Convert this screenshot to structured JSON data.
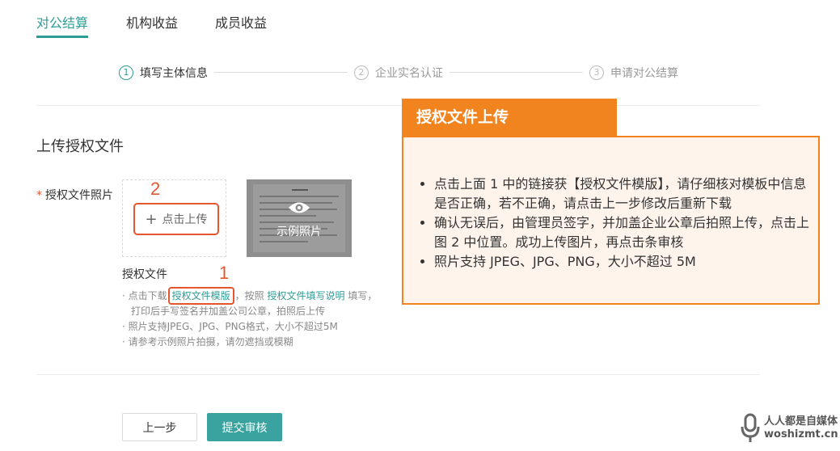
{
  "tabs": [
    {
      "label": "对公结算",
      "active": true
    },
    {
      "label": "机构收益",
      "active": false
    },
    {
      "label": "成员收益",
      "active": false
    }
  ],
  "steps": [
    {
      "num": "1",
      "label": "填写主体信息",
      "active": true
    },
    {
      "num": "2",
      "label": "企业实名认证",
      "active": false
    },
    {
      "num": "3",
      "label": "申请对公结算",
      "active": false
    }
  ],
  "section_title": "上传授权文件",
  "field": {
    "required_mark": "*",
    "label": "授权文件照片"
  },
  "upload": {
    "plus": "+",
    "label": "点击上传"
  },
  "sample": {
    "label": "示例照片"
  },
  "annotations": {
    "one": "1",
    "two": "2"
  },
  "auth": {
    "title": "授权文件",
    "tip1_prefix": "· 点击下载",
    "tip1_link1": "授权文件模版",
    "tip1_mid": "，按照",
    "tip1_link2": "授权文件填写说明",
    "tip1_suffix": "填写，",
    "tip1_line2": "打印后手写签名并加盖公司公章，拍照后上传",
    "tip2": "· 照片支持JPEG、JPG、PNG格式，大小不超过5M",
    "tip3": "· 请参考示例照片拍摄，请勿遮挡或模糊"
  },
  "callout": {
    "title": "授权文件上传",
    "items": [
      "点击上面 1 中的链接获【授权文件模版】，请仔细核对模板中信息是否正确，若不正确，请点击上一步修改后重新下载",
      "确认无误后，由管理员签字，并加盖企业公章后拍照上传，点击上图 2 中位置。成功上传图片，再点击条审核",
      "照片支持 JPEG、JPG、PNG，大小不超过 5M"
    ]
  },
  "buttons": {
    "prev": "上一步",
    "submit": "提交审核"
  },
  "watermark": {
    "line1": "人人都是自媒体",
    "line2": "woshizmt.cn"
  },
  "colors": {
    "accent": "#2e9c97",
    "callout": "#f2841f",
    "annotation": "#e4572e"
  }
}
